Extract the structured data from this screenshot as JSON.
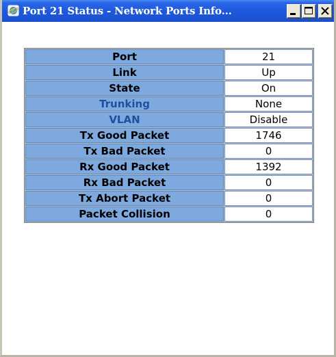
{
  "window": {
    "title": "Port 21 Status - Network Ports Info..."
  },
  "status_table": {
    "rows": [
      {
        "label": "Port",
        "value": "21"
      },
      {
        "label": "Link",
        "value": "Up"
      },
      {
        "label": "State",
        "value": "On"
      },
      {
        "label": "Trunking",
        "value": "None"
      },
      {
        "label": "VLAN",
        "value": "Disable"
      },
      {
        "label": "Tx Good Packet",
        "value": "1746"
      },
      {
        "label": "Tx Bad Packet",
        "value": "0"
      },
      {
        "label": "Rx Good Packet",
        "value": "1392"
      },
      {
        "label": "Rx Bad Packet",
        "value": "0"
      },
      {
        "label": "Tx Abort Packet",
        "value": "0"
      },
      {
        "label": "Packet Collision",
        "value": "0"
      }
    ]
  },
  "colors": {
    "titlebar": "#1d58dd",
    "label_cell": "#7da9de",
    "link_label_text": "#1f4f9e"
  }
}
